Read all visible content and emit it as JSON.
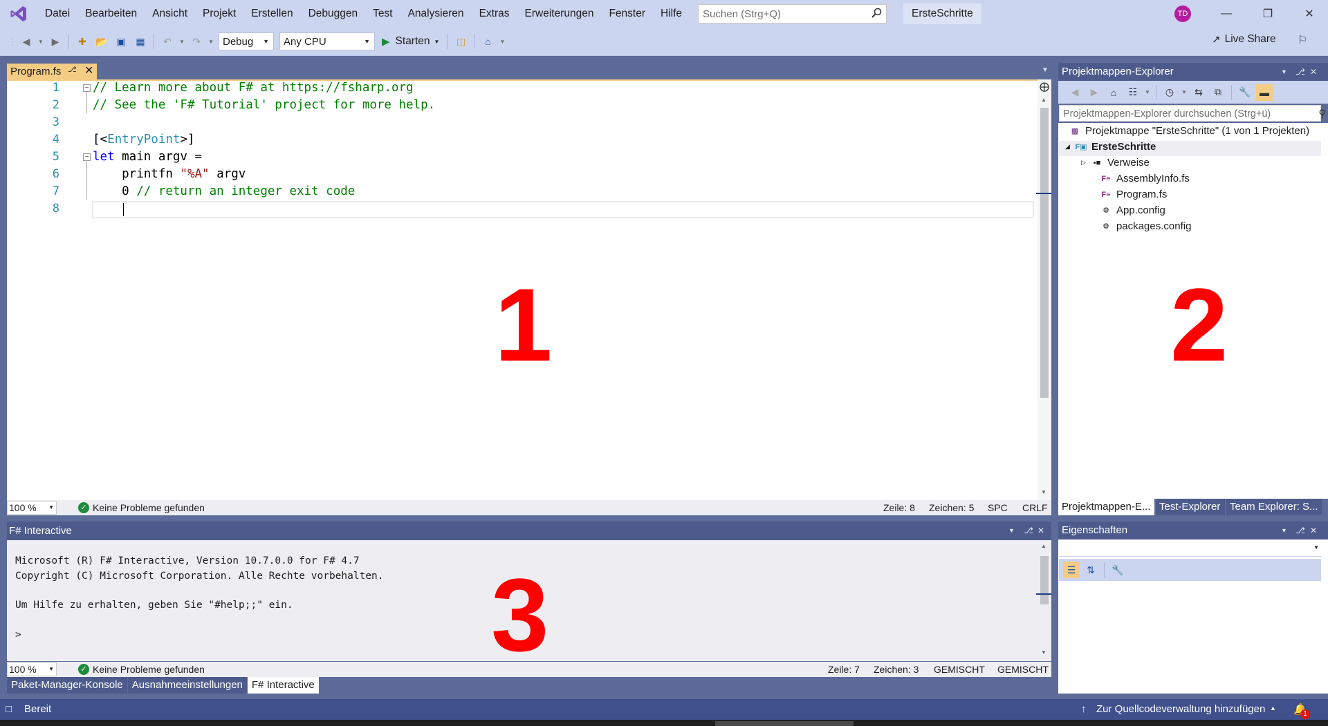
{
  "titlebar": {
    "menu": [
      "Datei",
      "Bearbeiten",
      "Ansicht",
      "Projekt",
      "Erstellen",
      "Debuggen",
      "Test",
      "Analysieren",
      "Extras",
      "Erweiterungen",
      "Fenster",
      "Hilfe"
    ],
    "search_placeholder": "Suchen (Strg+Q)",
    "solution_name": "ErsteSchritte",
    "avatar_initials": "TD"
  },
  "toolbar": {
    "config": "Debug",
    "platform": "Any CPU",
    "start_label": "Starten",
    "live_share": "Live Share"
  },
  "editor": {
    "tab_label": "Program.fs",
    "lines": [
      {
        "num": "1",
        "parts": [
          {
            "t": "// Learn more about F# at https://fsharp.org",
            "c": "comment"
          }
        ]
      },
      {
        "num": "2",
        "parts": [
          {
            "t": "// See the 'F# Tutorial' project for more help.",
            "c": "comment"
          }
        ]
      },
      {
        "num": "3",
        "parts": []
      },
      {
        "num": "4",
        "parts": [
          {
            "t": "[<",
            "c": ""
          },
          {
            "t": "EntryPoint",
            "c": "type"
          },
          {
            "t": ">]",
            "c": ""
          }
        ]
      },
      {
        "num": "5",
        "parts": [
          {
            "t": "let",
            "c": "keyword"
          },
          {
            "t": " main argv =",
            "c": ""
          }
        ]
      },
      {
        "num": "6",
        "parts": [
          {
            "t": "    printfn ",
            "c": ""
          },
          {
            "t": "\"%A\"",
            "c": "string"
          },
          {
            "t": " argv",
            "c": ""
          }
        ]
      },
      {
        "num": "7",
        "parts": [
          {
            "t": "    0 ",
            "c": ""
          },
          {
            "t": "// return an integer exit code",
            "c": "comment"
          }
        ]
      },
      {
        "num": "8",
        "parts": []
      }
    ],
    "zoom": "100 %",
    "problems": "Keine Probleme gefunden",
    "line_label": "Zeile: 8",
    "char_label": "Zeichen: 5",
    "indent_mode": "SPC",
    "line_ending": "CRLF"
  },
  "fsi": {
    "title": "F# Interactive",
    "output_lines": [
      "Microsoft (R) F# Interactive, Version 10.7.0.0 for F# 4.7",
      "Copyright (C) Microsoft Corporation. Alle Rechte vorbehalten.",
      "",
      "Um Hilfe zu erhalten, geben Sie \"#help;;\" ein.",
      "",
      ">"
    ],
    "zoom": "100 %",
    "problems": "Keine Probleme gefunden",
    "line_label": "Zeile: 7",
    "char_label": "Zeichen: 3",
    "indent_mode": "GEMISCHT",
    "line_ending": "GEMISCHT"
  },
  "bottom_tabs": [
    "Paket-Manager-Konsole",
    "Ausnahmeeinstellungen",
    "F# Interactive"
  ],
  "solution_explorer": {
    "title": "Projektmappen-Explorer",
    "search_placeholder": "Projektmappen-Explorer durchsuchen (Strg+ü)",
    "solution_label": "Projektmappe \"ErsteSchritte\" (1 von 1 Projekten)",
    "project_label": "ErsteSchritte",
    "items": [
      "Verweise",
      "AssemblyInfo.fs",
      "Program.fs",
      "App.config",
      "packages.config"
    ],
    "tabs": [
      "Projektmappen-E...",
      "Test-Explorer",
      "Team Explorer: S..."
    ]
  },
  "properties": {
    "title": "Eigenschaften"
  },
  "statusbar": {
    "ready": "Bereit",
    "source_control": "Zur Quellcodeverwaltung hinzufügen",
    "notifications": "1"
  },
  "annotations": [
    "1",
    "2",
    "3"
  ],
  "colors": {
    "accent": "#5d6b99",
    "chrome": "#ccd5f0",
    "tab_active": "#f5cc84",
    "annotation": "#ff0000",
    "avatar": "#b31d9e"
  }
}
